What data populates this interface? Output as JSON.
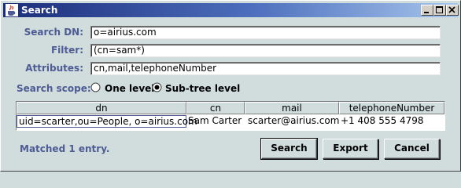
{
  "window": {
    "title": "Search",
    "titlebar_colors": {
      "start": "#1b2d7a",
      "end": "#a7c6ec"
    },
    "controls": [
      "minimize-icon",
      "maximize-icon",
      "close-icon"
    ]
  },
  "form": {
    "search_dn_label": "Search DN:",
    "search_dn_value": "o=airius.com",
    "filter_label": "Filter:",
    "filter_value": "(cn=sam*)",
    "attributes_label": "Attributes:",
    "attributes_value": "cn,mail,telephoneNumber",
    "scope_label": "Search scope:",
    "scope_options": [
      {
        "label": "One level",
        "selected": false
      },
      {
        "label": "Sub-tree level",
        "selected": true
      }
    ]
  },
  "results": {
    "columns": [
      "dn",
      "cn",
      "mail",
      "telephoneNumber"
    ],
    "rows": [
      [
        "uid=scarter,ou=People, o=airius.com",
        "Sam Carter",
        "scarter@airius.com",
        "+1 408 555 4798"
      ]
    ]
  },
  "status": {
    "text": "Matched 1 entry."
  },
  "buttons": {
    "search": "Search",
    "export": "Export",
    "cancel": "Cancel"
  },
  "colors": {
    "label": "#4e5b94",
    "background": "#d1dddd"
  }
}
